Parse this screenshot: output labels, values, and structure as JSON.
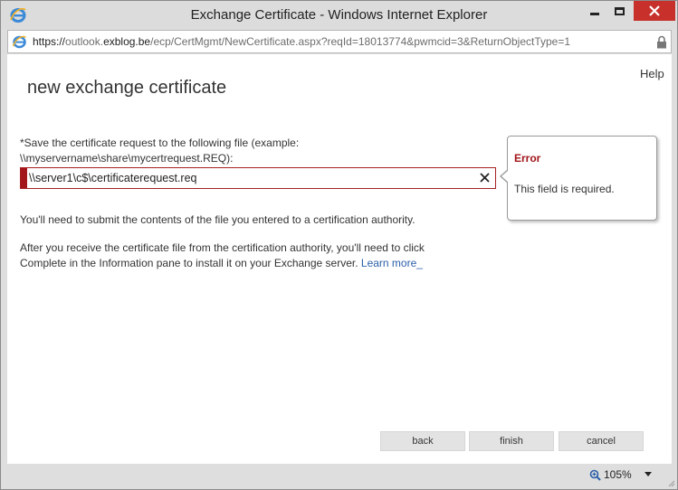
{
  "window": {
    "title": "Exchange Certificate - Windows Internet Explorer"
  },
  "address_bar": {
    "scheme": "https://",
    "host_prefix": "outlook.",
    "domain": "exblog.be",
    "path": "/ecp/CertMgmt/NewCertificate.aspx?reqId=18013774&pwmcid=3&ReturnObjectType=1"
  },
  "page": {
    "help_label": "Help",
    "title": "new exchange certificate",
    "field_label": "*Save the certificate request to the following file (example: \\\\myservername\\share\\mycertrequest.REQ):",
    "field_value": "\\\\server1\\c$\\certificaterequest.req",
    "info_1": "You'll need to submit the contents of the file you entered to a certification authority.",
    "info_2": "After you receive the certificate file from the certification authority, you'll need to click Complete in the Information pane to install it on your Exchange server.",
    "learn_more": "Learn more_"
  },
  "error": {
    "title": "Error",
    "message": "This field is required."
  },
  "buttons": {
    "back": "back",
    "finish": "finish",
    "cancel": "cancel"
  },
  "status_bar": {
    "zoom": "105%"
  },
  "colors": {
    "error_red": "#a3161c",
    "close_button": "#c7302b",
    "link_blue": "#2a5fa8"
  },
  "icons": [
    "ie-logo-icon",
    "ie-page-icon",
    "lock-icon",
    "close-icon",
    "clear-icon",
    "zoom-icon",
    "chevron-down-icon"
  ]
}
